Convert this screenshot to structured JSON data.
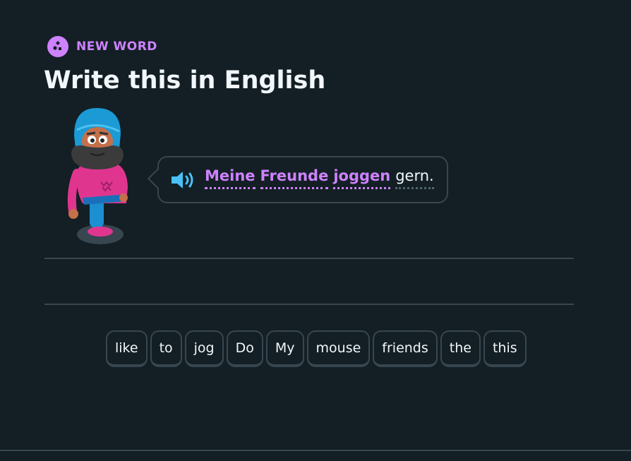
{
  "header": {
    "badge_label": "NEW WORD",
    "badge_icon": "puzzle-icon",
    "title": "Write this in English"
  },
  "prompt": {
    "speaker_icon": "speaker-icon",
    "words": [
      {
        "text": "Meine",
        "new": true
      },
      {
        "text": "Freunde",
        "new": true
      },
      {
        "text": "joggen",
        "new": true
      },
      {
        "text": "gern.",
        "new": false
      }
    ]
  },
  "word_bank": [
    "like",
    "to",
    "jog",
    "Do",
    "My",
    "mouse",
    "friends",
    "the",
    "this"
  ],
  "colors": {
    "background": "#131f24",
    "accent_purple": "#ce82ff",
    "border": "#37464f",
    "speaker_blue": "#49c0f8",
    "text": "#f1f7fb"
  }
}
